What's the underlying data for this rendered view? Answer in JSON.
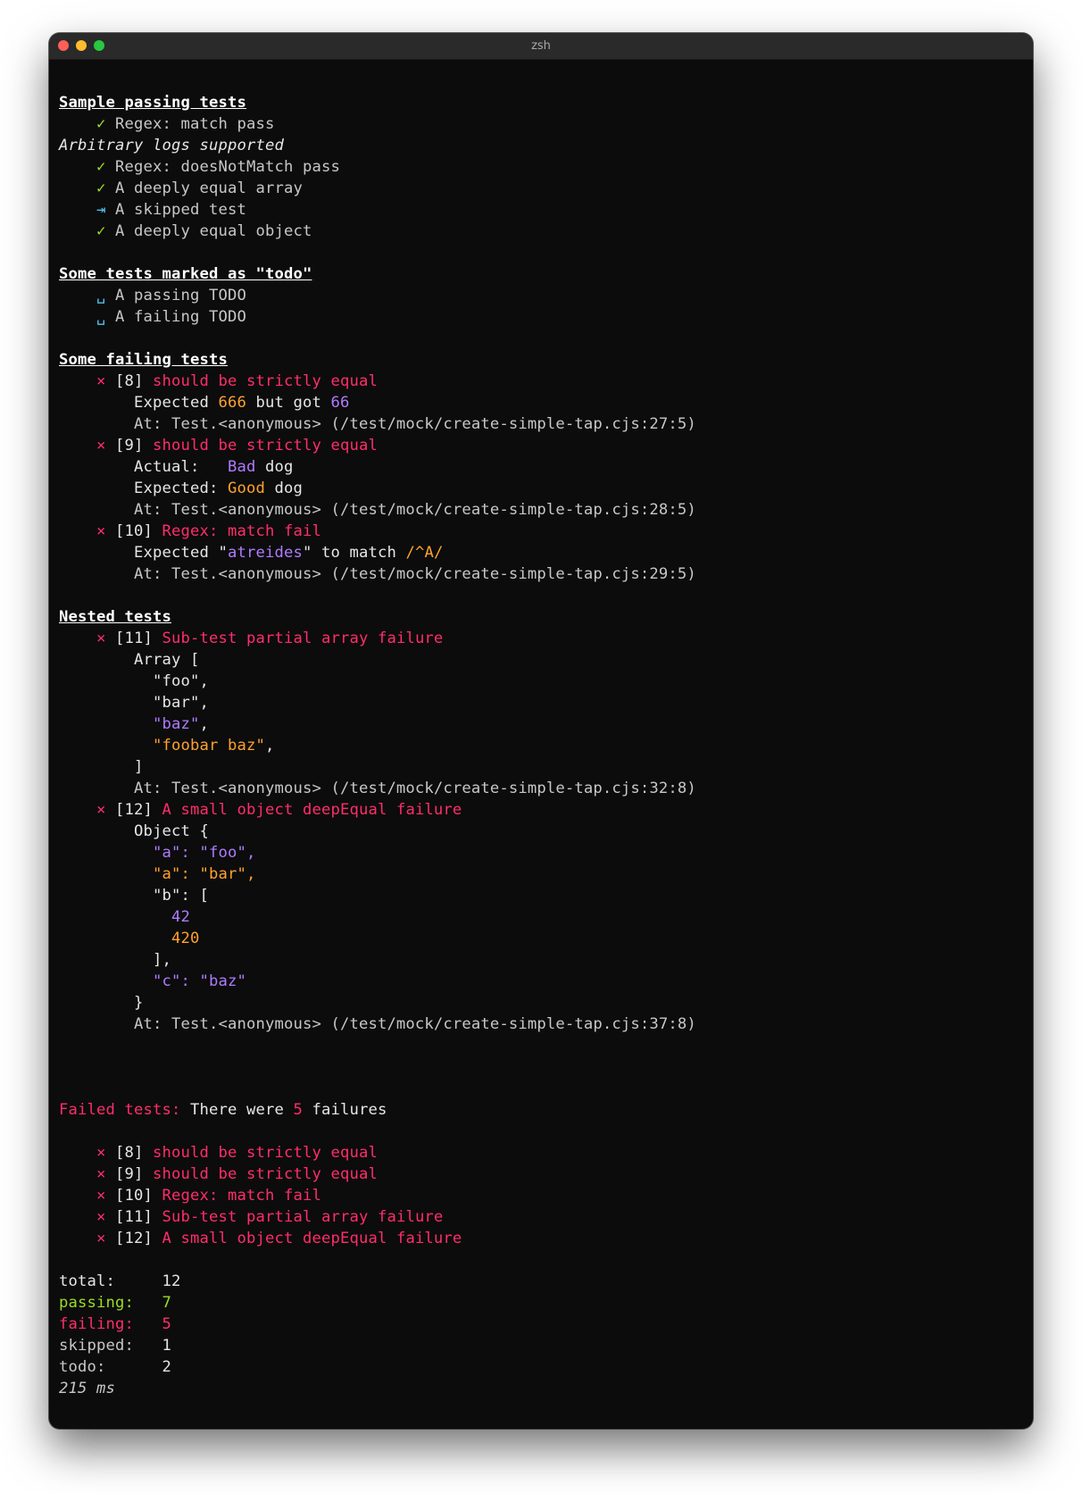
{
  "window": {
    "title": "zsh",
    "colors": {
      "background": "#0c0c0c",
      "pass": "#9bdc28",
      "fail": "#ff2d6b",
      "skip": "#4fc1e9",
      "expected": "#ffa22e",
      "actual": "#b07bff"
    }
  },
  "icons": {
    "pass": "✓",
    "fail": "×",
    "skip": "⇥",
    "todo": "␣"
  },
  "sections": {
    "passing": {
      "heading": "Sample passing tests",
      "t1": "Regex: match pass",
      "log": "Arbitrary logs supported",
      "t2": "Regex: doesNotMatch pass",
      "t3": "A deeply equal array",
      "t4": "A skipped test",
      "t5": "A deeply equal object"
    },
    "todo": {
      "heading": "Some tests marked as \"todo\"",
      "t1": "A passing TODO",
      "t2": "A failing TODO"
    },
    "failing": {
      "heading": "Some failing tests",
      "f8": {
        "id": "[8]",
        "name": "should be strictly equal",
        "expected_prefix": "Expected ",
        "expected_val": "666",
        "mid": " but got ",
        "actual_val": "66",
        "at": "At: Test.<anonymous> (/test/mock/create-simple-tap.cjs:27:5)"
      },
      "f9": {
        "id": "[9]",
        "name": "should be strictly equal",
        "actual_label": "Actual:   ",
        "actual_word": "Bad",
        "actual_rest": " dog",
        "expected_label": "Expected: ",
        "expected_word": "Good",
        "expected_rest": " dog",
        "at": "At: Test.<anonymous> (/test/mock/create-simple-tap.cjs:28:5)"
      },
      "f10": {
        "id": "[10]",
        "name": "Regex: match fail",
        "prefix": "Expected \"",
        "value": "atreides",
        "mid": "\" to match ",
        "regex": "/^A/",
        "at": "At: Test.<anonymous> (/test/mock/create-simple-tap.cjs:29:5)"
      }
    },
    "nested": {
      "heading": "Nested tests",
      "f11": {
        "id": "[11]",
        "name": "Sub-test partial array failure",
        "open": "Array [",
        "i1": "\"foo\",",
        "i2": "\"bar\",",
        "i3": "\"baz\"",
        "i4": "\"foobar baz\"",
        "comma": ",",
        "close": "]",
        "at": "At: Test.<anonymous> (/test/mock/create-simple-tap.cjs:32:8)"
      },
      "f12": {
        "id": "[12]",
        "name": "A small object deepEqual failure",
        "open": "Object {",
        "a1": "\"a\": \"foo\",",
        "a2": "\"a\": \"bar\",",
        "b_open": "\"b\": [",
        "n1": "42",
        "n2": "420",
        "b_close": "],",
        "c": "\"c\": \"baz\"",
        "close": "}",
        "at": "At: Test.<anonymous> (/test/mock/create-simple-tap.cjs:37:8)"
      }
    }
  },
  "summary": {
    "failed_label": "Failed tests:",
    "there_were": " There were ",
    "count": "5",
    "failures_word": " failures",
    "list": [
      {
        "id": "[8]",
        "name": "should be strictly equal"
      },
      {
        "id": "[9]",
        "name": "should be strictly equal"
      },
      {
        "id": "[10]",
        "name": "Regex: match fail"
      },
      {
        "id": "[11]",
        "name": "Sub-test partial array failure"
      },
      {
        "id": "[12]",
        "name": "A small object deepEqual failure"
      }
    ],
    "stats": {
      "total_label": "total:     ",
      "total": "12",
      "passing_label": "passing:   ",
      "passing": "7",
      "failing_label": "failing:   ",
      "failing": "5",
      "skipped_label": "skipped:   ",
      "skipped": "1",
      "todo_label": "todo:      ",
      "todo": "2",
      "duration": "215 ms"
    }
  }
}
